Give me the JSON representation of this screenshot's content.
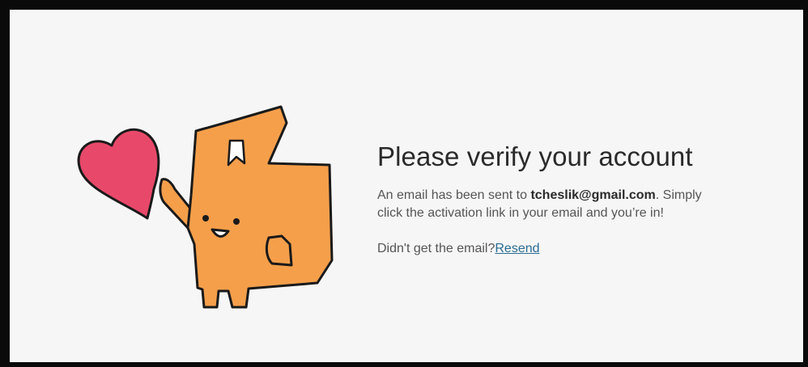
{
  "verify": {
    "title": "Please verify your account",
    "message_prefix": "An email has been sent to ",
    "email": "tcheslik@gmail.com",
    "message_line1_suffix": ". Simply",
    "message_line2": "click the activation link in your email and you’re in!",
    "resend_prompt": "Didn't get the email?",
    "resend_link": "Resend"
  },
  "illustration": {
    "icon": "box-mascot-holding-heart-icon",
    "colors": {
      "body": "#f59f4b",
      "heart": "#e8496a",
      "outline": "#1a1a1a"
    }
  }
}
